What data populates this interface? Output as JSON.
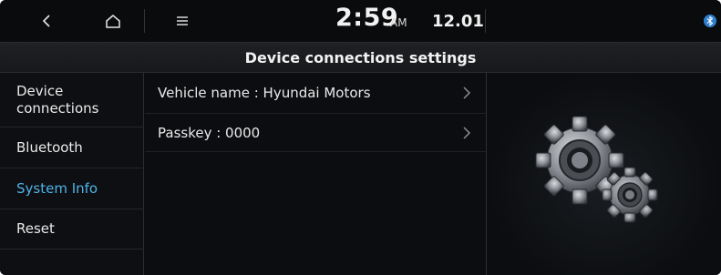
{
  "statusbar": {
    "back_icon": "chevron-left-icon",
    "home_icon": "home-icon",
    "menu_icon": "menu-icon",
    "time": "2:59",
    "ampm": "AM",
    "date": "12.01",
    "status_icon": "bluetooth-icon"
  },
  "title": "Device connections settings",
  "sidebar": {
    "items": [
      {
        "label": "Device connections",
        "active": false
      },
      {
        "label": "Bluetooth",
        "active": false
      },
      {
        "label": "System Info",
        "active": true
      },
      {
        "label": "Reset",
        "active": false
      }
    ]
  },
  "main": {
    "rows": [
      {
        "label": "Vehicle name : Hyundai Motors"
      },
      {
        "label": "Passkey : 0000"
      }
    ]
  },
  "illustration": {
    "icon": "gears-icon"
  },
  "colors": {
    "accent": "#4fb3e8",
    "background": "#0b0d10",
    "text": "#eaeaea"
  }
}
